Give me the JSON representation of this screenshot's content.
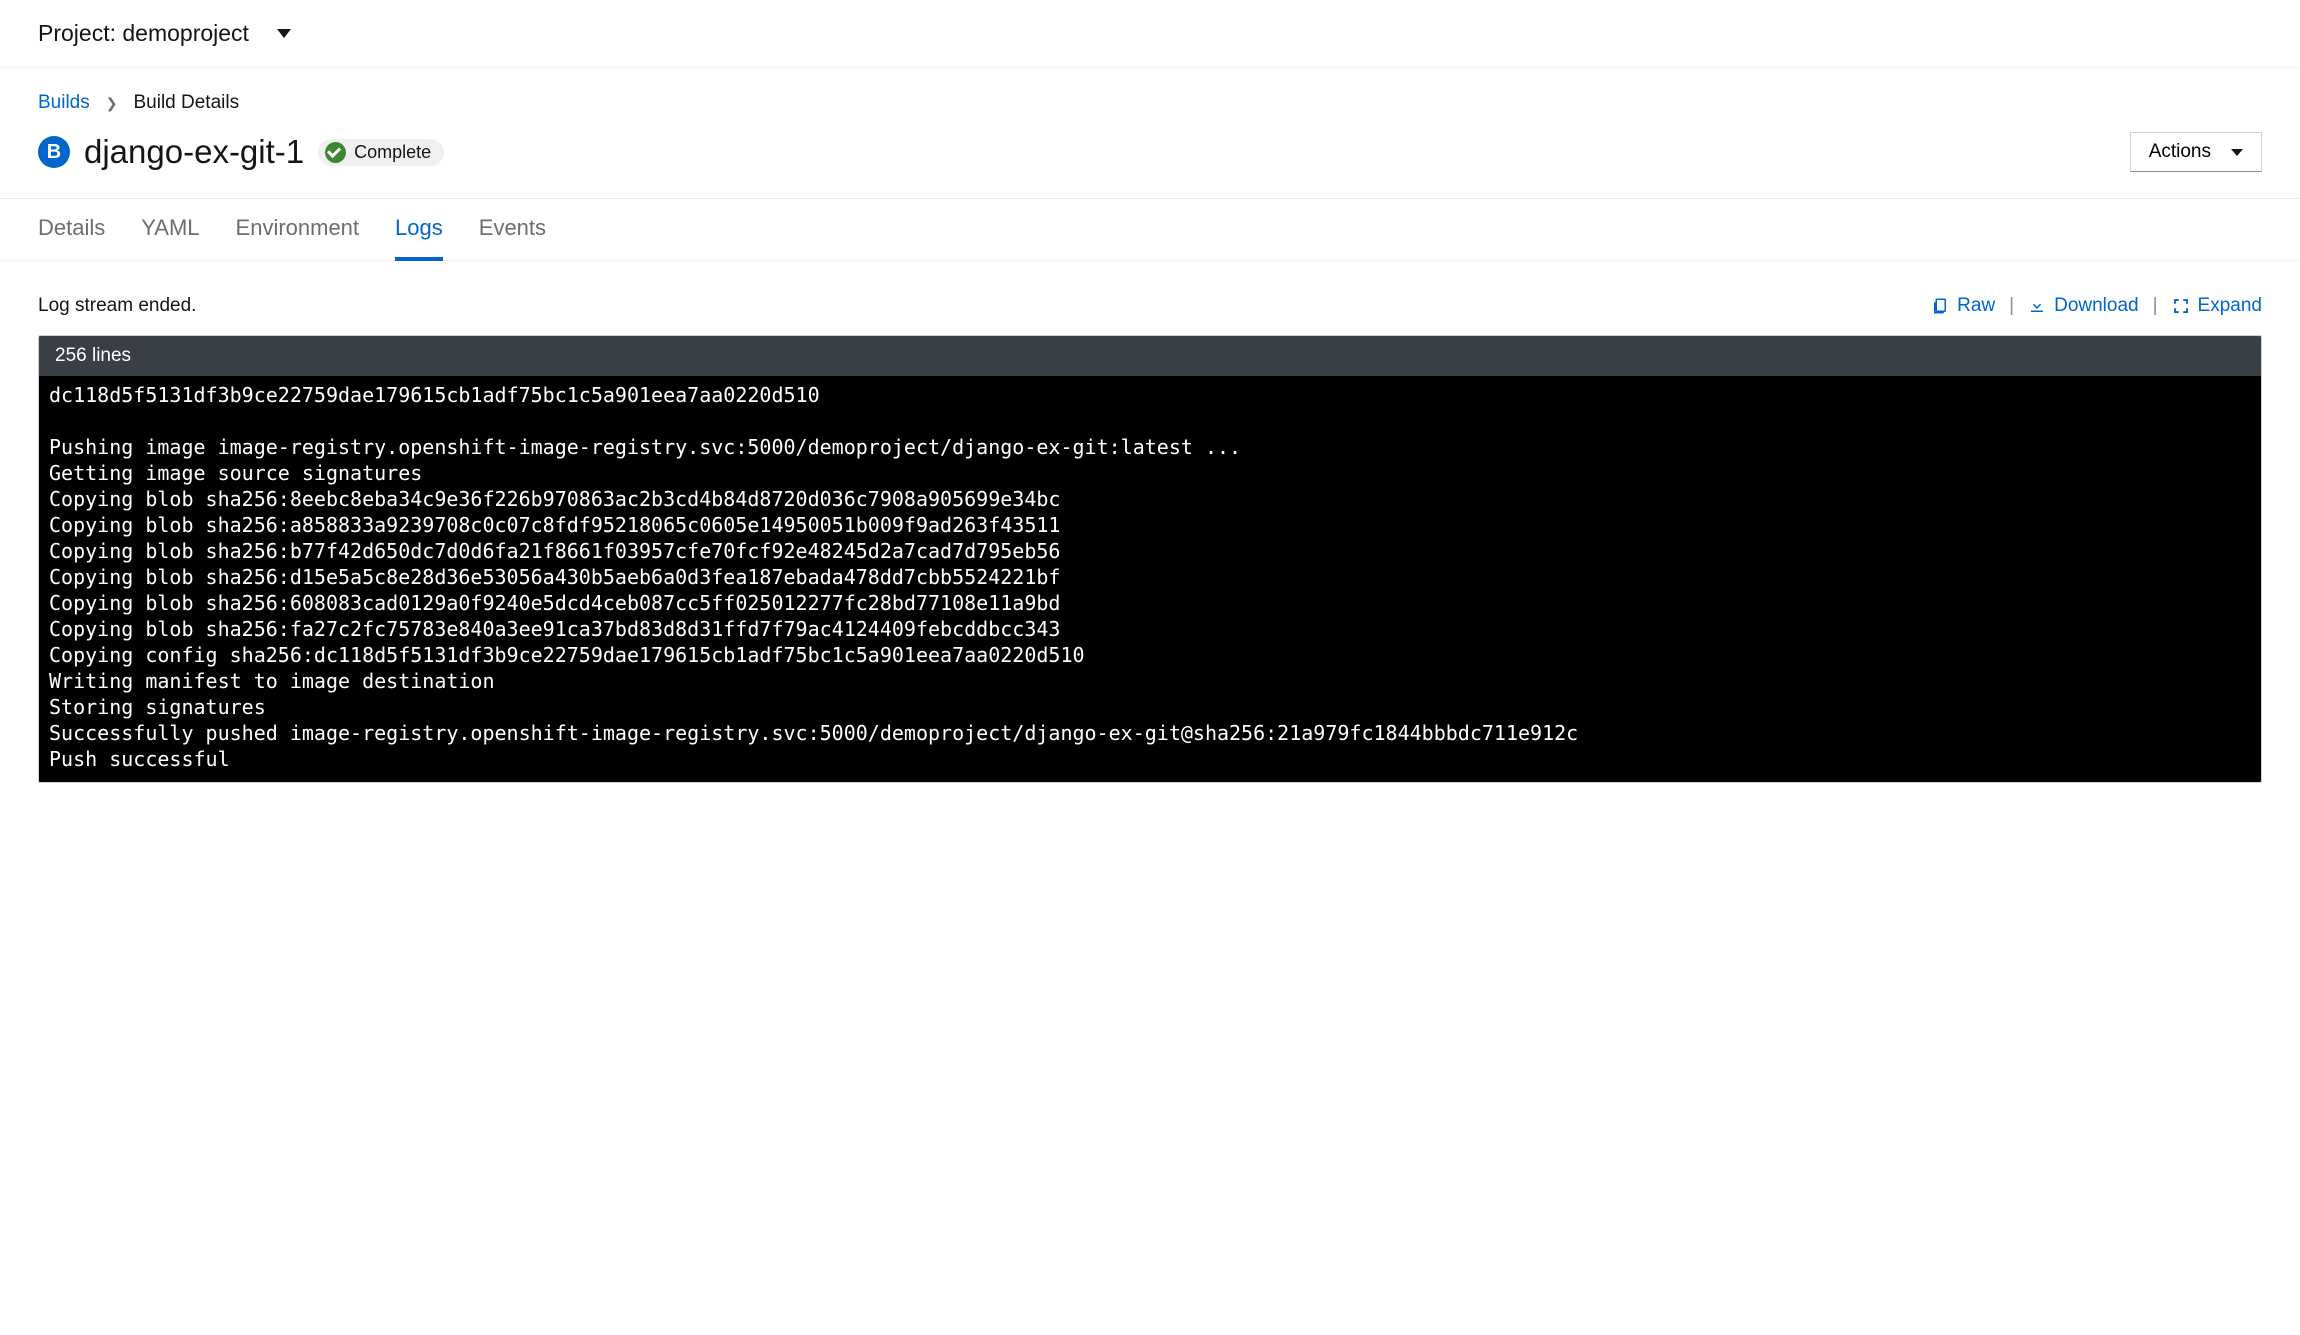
{
  "topbar": {
    "project_label": "Project:",
    "project_name": "demoproject"
  },
  "breadcrumb": {
    "root": "Builds",
    "current": "Build Details"
  },
  "title": {
    "icon_letter": "B",
    "name": "django-ex-git-1",
    "status": "Complete"
  },
  "actions_label": "Actions",
  "tabs": [
    {
      "label": "Details",
      "active": false
    },
    {
      "label": "YAML",
      "active": false
    },
    {
      "label": "Environment",
      "active": false
    },
    {
      "label": "Logs",
      "active": true
    },
    {
      "label": "Events",
      "active": false
    }
  ],
  "logs": {
    "status_text": "Log stream ended.",
    "raw_label": "Raw",
    "download_label": "Download",
    "expand_label": "Expand",
    "line_count_label": "256 lines",
    "lines": [
      "dc118d5f5131df3b9ce22759dae179615cb1adf75bc1c5a901eea7aa0220d510",
      "",
      "Pushing image image-registry.openshift-image-registry.svc:5000/demoproject/django-ex-git:latest ...",
      "Getting image source signatures",
      "Copying blob sha256:8eebc8eba34c9e36f226b970863ac2b3cd4b84d8720d036c7908a905699e34bc",
      "Copying blob sha256:a858833a9239708c0c07c8fdf95218065c0605e14950051b009f9ad263f43511",
      "Copying blob sha256:b77f42d650dc7d0d6fa21f8661f03957cfe70fcf92e48245d2a7cad7d795eb56",
      "Copying blob sha256:d15e5a5c8e28d36e53056a430b5aeb6a0d3fea187ebada478dd7cbb5524221bf",
      "Copying blob sha256:608083cad0129a0f9240e5dcd4ceb087cc5ff025012277fc28bd77108e11a9bd",
      "Copying blob sha256:fa27c2fc75783e840a3ee91ca37bd83d8d31ffd7f79ac4124409febcddbcc343",
      "Copying config sha256:dc118d5f5131df3b9ce22759dae179615cb1adf75bc1c5a901eea7aa0220d510",
      "Writing manifest to image destination",
      "Storing signatures",
      "Successfully pushed image-registry.openshift-image-registry.svc:5000/demoproject/django-ex-git@sha256:21a979fc1844bbbdc711e912c",
      "Push successful"
    ]
  }
}
